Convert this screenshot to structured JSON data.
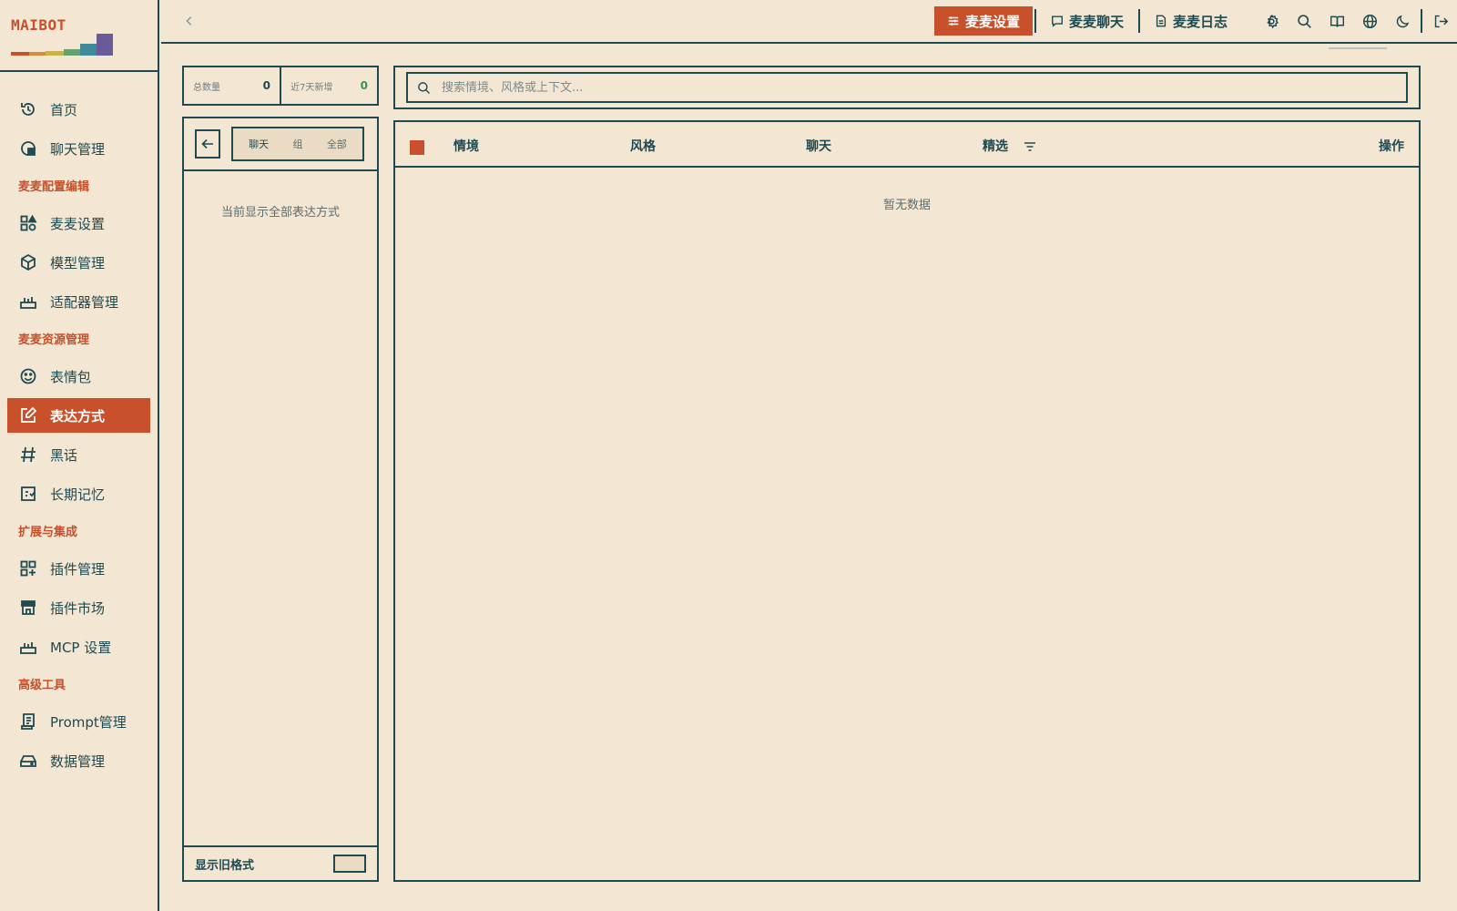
{
  "brand": {
    "name": "MAIBOT",
    "bar_colors": [
      "#c8502a",
      "#d98a3a",
      "#c9b24a",
      "#6aa06e",
      "#3e8a99",
      "#6b5a9a"
    ]
  },
  "sidebar": {
    "items": [
      {
        "label": "首页",
        "icon": "home-icon"
      },
      {
        "label": "聊天管理",
        "icon": "chat-icon"
      }
    ],
    "section1": "麦麦配置编辑",
    "config_items": [
      {
        "label": "麦麦设置",
        "icon": "shapes-icon"
      },
      {
        "label": "模型管理",
        "icon": "box-icon"
      },
      {
        "label": "适配器管理",
        "icon": "router-icon"
      }
    ],
    "section2": "麦麦资源管理",
    "resource_items": [
      {
        "label": "表情包",
        "icon": "smile-icon"
      },
      {
        "label": "表达方式",
        "icon": "edit-icon"
      },
      {
        "label": "黑话",
        "icon": "hash-icon"
      },
      {
        "label": "长期记忆",
        "icon": "memory-icon"
      }
    ],
    "section3": "扩展与集成",
    "ext_items": [
      {
        "label": "插件管理",
        "icon": "grid-plus-icon"
      },
      {
        "label": "插件市场",
        "icon": "store-icon"
      },
      {
        "label": "MCP 设置",
        "icon": "router-icon"
      }
    ],
    "section4": "高级工具",
    "adv_items": [
      {
        "label": "Prompt管理",
        "icon": "scroll-icon"
      },
      {
        "label": "数据管理",
        "icon": "drive-icon"
      }
    ],
    "active": "表达方式"
  },
  "topbar": {
    "settings_label": "麦麦设置",
    "chat_label": "麦麦聊天",
    "log_label": "麦麦日志"
  },
  "stats": {
    "total_label": "总数量",
    "total_value": "0",
    "new_label": "近7天新增",
    "new_value": "0"
  },
  "filter": {
    "seg_chat": "聊天",
    "seg_group": "组",
    "seg_all": "全部",
    "current_note": "当前显示全部表达方式",
    "legacy_label": "显示旧格式"
  },
  "search": {
    "placeholder": "搜索情境、风格或上下文..."
  },
  "table": {
    "columns": [
      "情境",
      "风格",
      "聊天",
      "精选",
      "操作"
    ],
    "empty_text": "暂无数据"
  },
  "colors": {
    "accent": "#c8502a",
    "ink": "#1e4a52",
    "background": "#f3e6d3",
    "positive": "#2d9a4a"
  }
}
